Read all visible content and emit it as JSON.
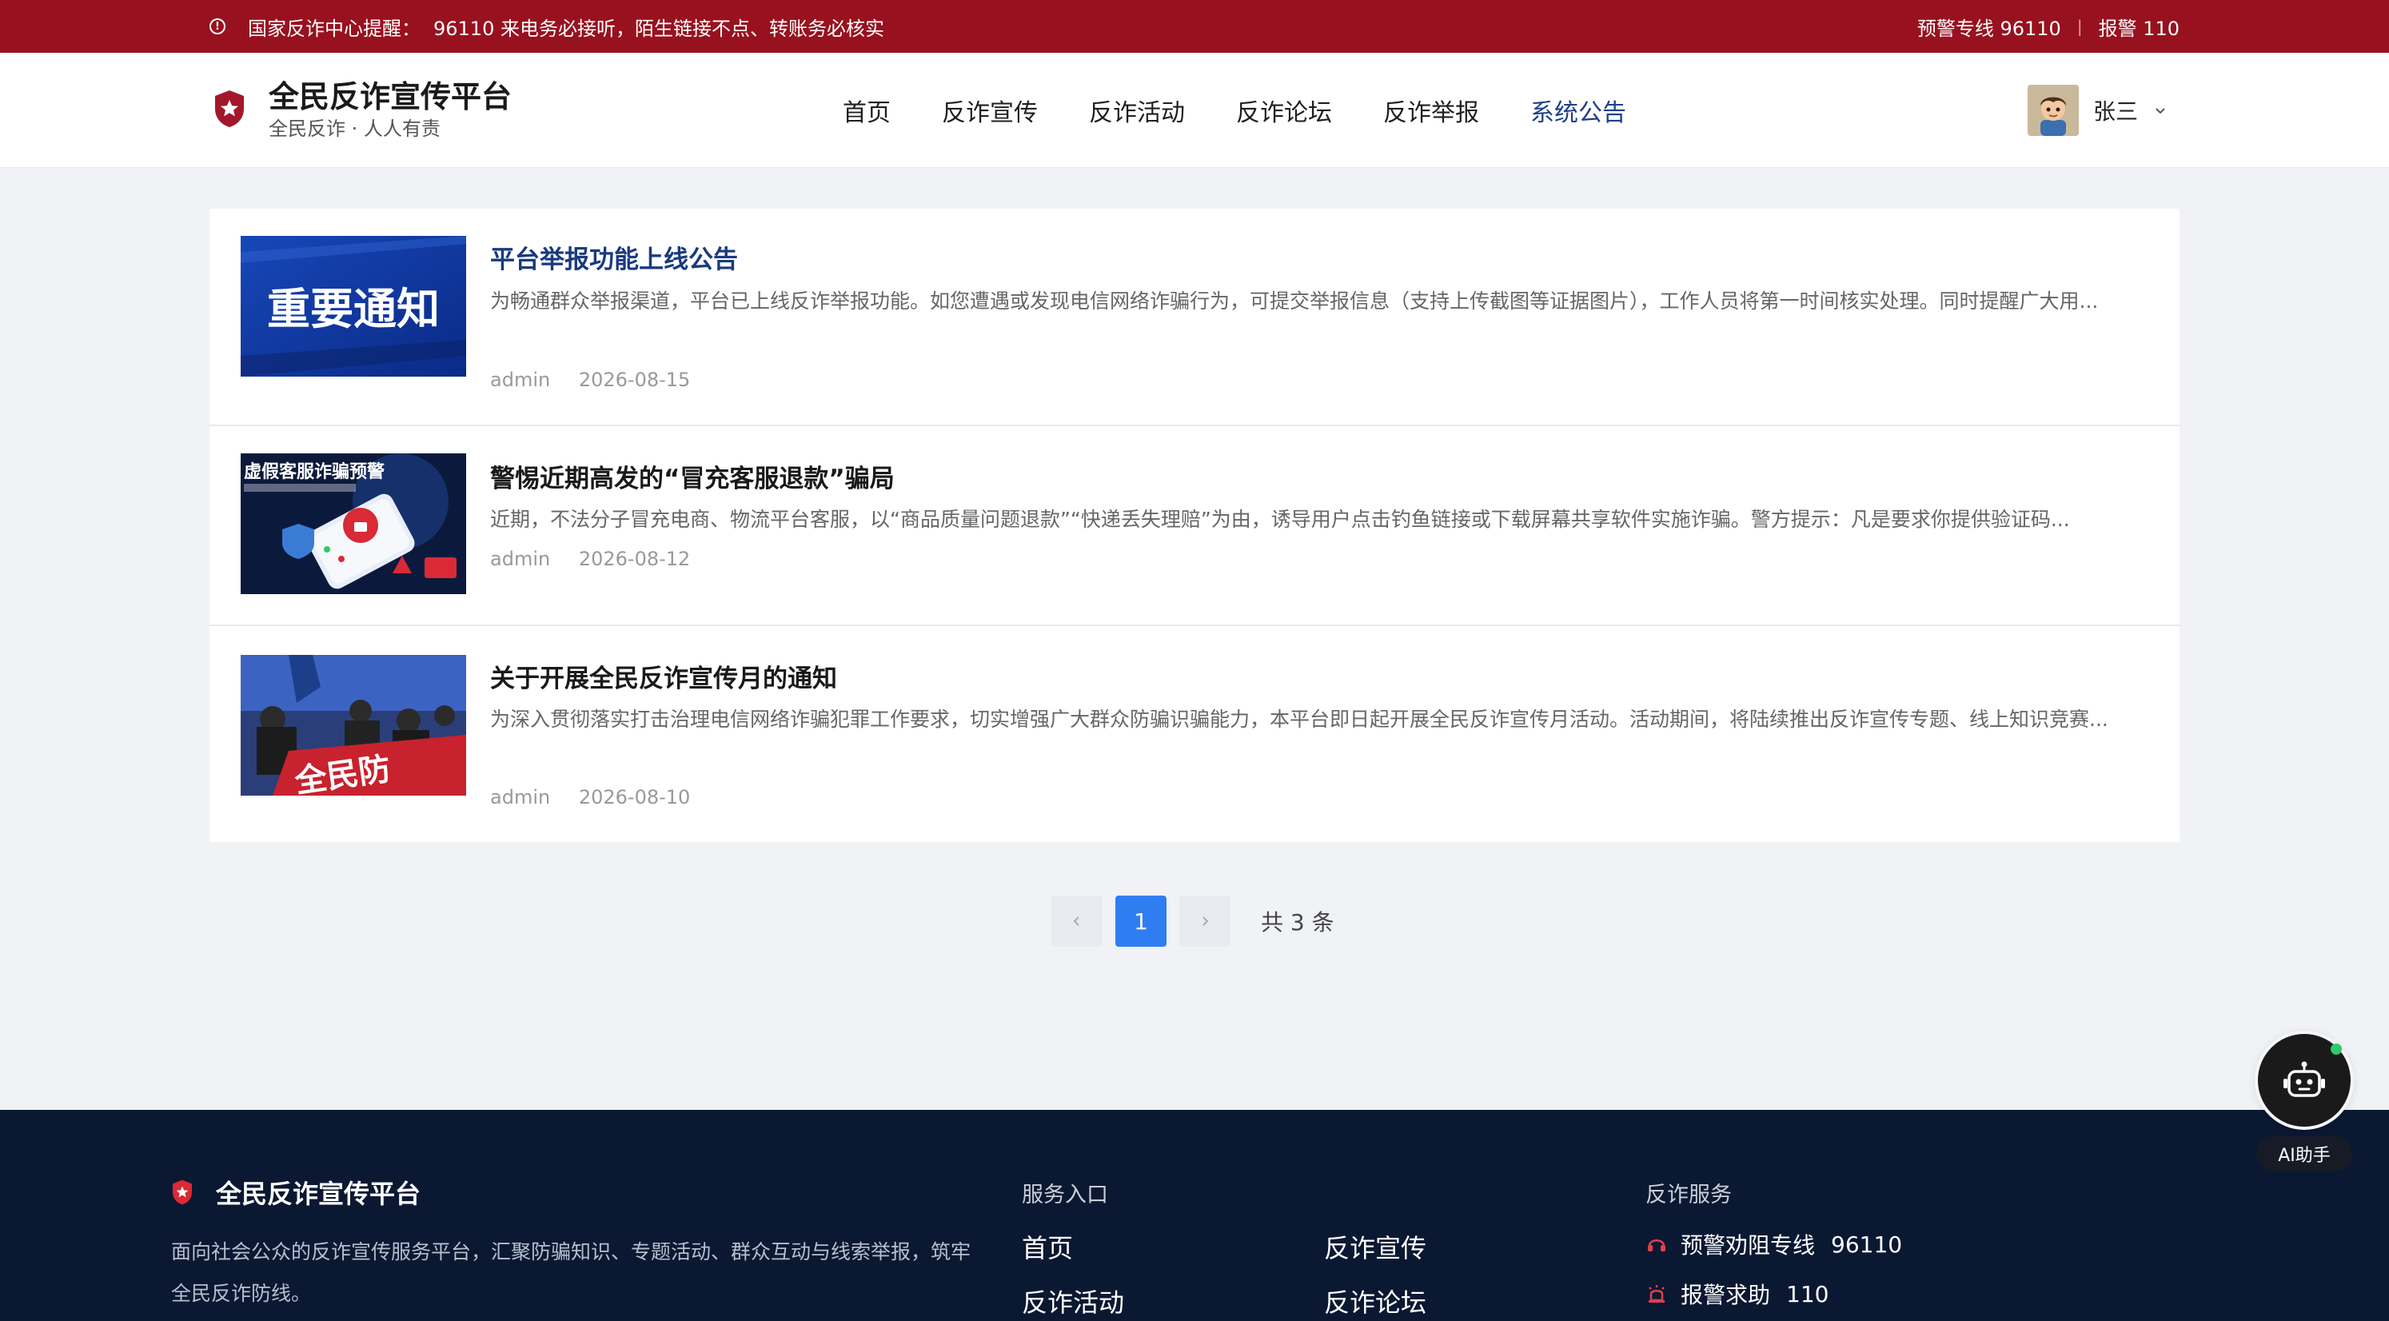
{
  "alert": {
    "prefix": "国家反诈中心提醒：",
    "message": "96110 来电务必接听，陌生链接不点、转账务必核实",
    "hotline": "预警专线 96110",
    "sep": "|",
    "police": "报警 110"
  },
  "brand": {
    "title": "全民反诈宣传平台",
    "subtitle": "全民反诈 · 人人有责"
  },
  "nav": {
    "items": [
      {
        "label": "首页"
      },
      {
        "label": "反诈宣传"
      },
      {
        "label": "反诈活动"
      },
      {
        "label": "反诈论坛"
      },
      {
        "label": "反诈举报"
      },
      {
        "label": "系统公告"
      }
    ],
    "active": "系统公告"
  },
  "user": {
    "name": "张三"
  },
  "announcements": [
    {
      "title": "平台举报功能上线公告",
      "summary": "为畅通群众举报渠道，平台已上线反诈举报功能。如您遭遇或发现电信网络诈骗行为，可提交举报信息（支持上传截图等证据图片），工作人员将第一时间核实处理。同时提醒广大用...",
      "author": "admin",
      "date": "2026-08-15",
      "thumb_text": "重要通知"
    },
    {
      "title": "警惕近期高发的“冒充客服退款”骗局",
      "summary": "近期，不法分子冒充电商、物流平台客服，以“商品质量问题退款”“快递丢失理赔”为由，诱导用户点击钓鱼链接或下载屏幕共享软件实施诈骗。警方提示：凡是要求你提供验证码...",
      "author": "admin",
      "date": "2026-08-12",
      "thumb_text": "虚假客服诈骗预警"
    },
    {
      "title": "关于开展全民反诈宣传月的通知",
      "summary": "为深入贯彻落实打击治理电信网络诈骗犯罪工作要求，切实增强广大群众防骗识骗能力，本平台即日起开展全民反诈宣传月活动。活动期间，将陆续推出反诈宣传专题、线上知识竞赛...",
      "author": "admin",
      "date": "2026-08-10",
      "thumb_text": "全民防"
    }
  ],
  "pagination": {
    "current": "1",
    "total_text": "共 3 条"
  },
  "ai": {
    "label": "AI助手"
  },
  "footer": {
    "brand": "全民反诈宣传平台",
    "description": "面向社会公众的反诈宣传服务平台，汇聚防骗知识、专题活动、群众互动与线索举报，筑牢全民反诈防线。",
    "service_entry_title": "服务入口",
    "service_links": [
      "首页",
      "反诈宣传",
      "反诈活动",
      "反诈论坛"
    ],
    "anti_fraud_title": "反诈服务",
    "hotline_label": "预警劝阻专线",
    "hotline_number": "96110",
    "police_label": "报警求助",
    "police_number": "110"
  },
  "colors": {
    "alert_bg": "#98111f",
    "active_nav": "#1d3f8a",
    "page_bg": "#f0f2f5",
    "pager_active": "#2f7ef1",
    "footer_bg": "#0b1832"
  }
}
